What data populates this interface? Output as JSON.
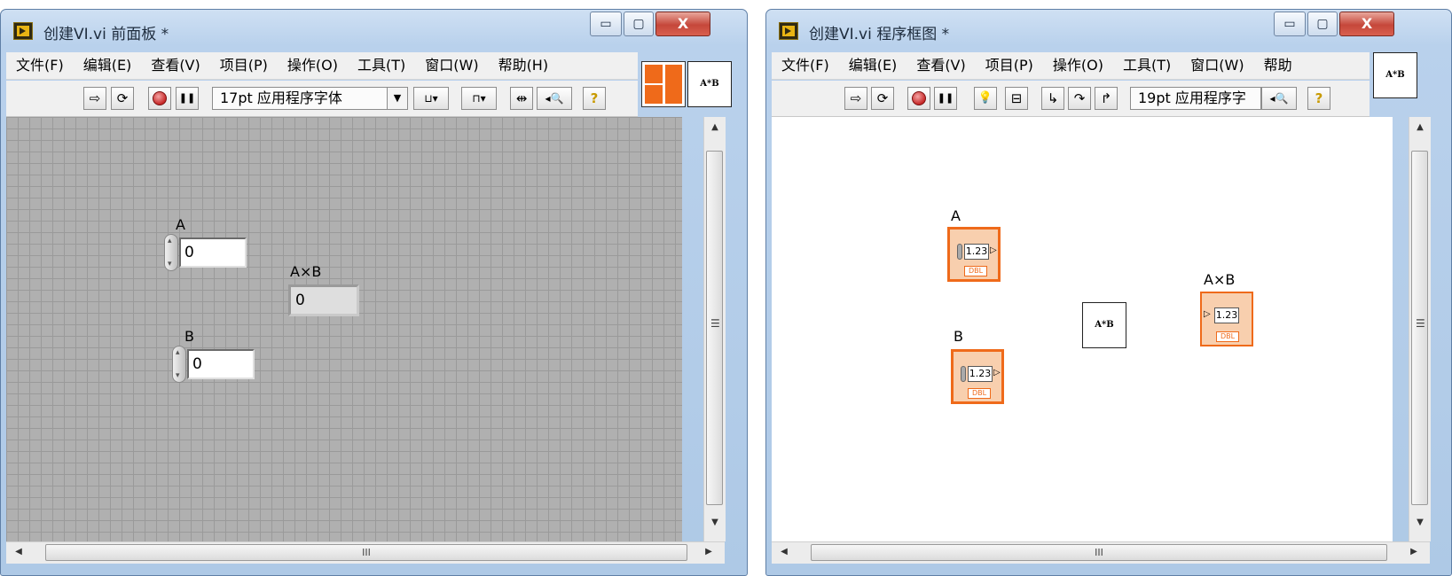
{
  "front_panel": {
    "title": "创建VI.vi 前面板 *",
    "window_buttons": {
      "minimize": "▭",
      "maximize": "▢",
      "close": "X"
    },
    "menu": [
      "文件(F)",
      "编辑(E)",
      "查看(V)",
      "项目(P)",
      "操作(O)",
      "工具(T)",
      "窗口(W)",
      "帮助(H)"
    ],
    "toolbar": {
      "run": "⇨",
      "run_continuously": "⟳",
      "pause": "❚❚",
      "font": "17pt 应用程序字体",
      "font_dropdown": "▼",
      "align": "⊔▾",
      "distribute": "⊓▾",
      "resize": "⇹",
      "reorder": "◂🔍",
      "help": "?"
    },
    "icon_text": "A*B",
    "controls": {
      "a_label": "A",
      "a_value": "0",
      "b_label": "B",
      "b_value": "0",
      "product_label": "A×B",
      "product_value": "0"
    },
    "scroll": {
      "h_grip": "III",
      "v_grip": "☰",
      "up": "▲",
      "down": "▼",
      "left": "◀",
      "right": "▶"
    }
  },
  "block_diagram": {
    "title": "创建VI.vi 程序框图 *",
    "window_buttons": {
      "minimize": "▭",
      "maximize": "▢",
      "close": "X"
    },
    "menu": [
      "文件(F)",
      "编辑(E)",
      "查看(V)",
      "项目(P)",
      "操作(O)",
      "工具(T)",
      "窗口(W)",
      "帮助"
    ],
    "toolbar": {
      "run": "⇨",
      "run_continuously": "⟳",
      "pause": "❚❚",
      "highlight": "💡",
      "retain": "⊟",
      "step_into": "↳",
      "step_over": "↷",
      "step_out": "↱",
      "font": "19pt 应用程序字",
      "reorder": "◂🔍",
      "help": "?"
    },
    "icon_text": "A*B",
    "terminals": {
      "a_label": "A",
      "b_label": "B",
      "product_label": "A×B",
      "value": "1.23",
      "dtype": "DBL"
    },
    "node_text": "A*B",
    "scroll": {
      "h_grip": "III",
      "v_grip": "☰",
      "up": "▲",
      "down": "▼",
      "left": "◀",
      "right": "▶"
    }
  },
  "colors": {
    "terminal_orange": "#ef6a1a",
    "panel_grid_bg": "#b0b0b0",
    "title_blue": "#b9d1ec"
  }
}
